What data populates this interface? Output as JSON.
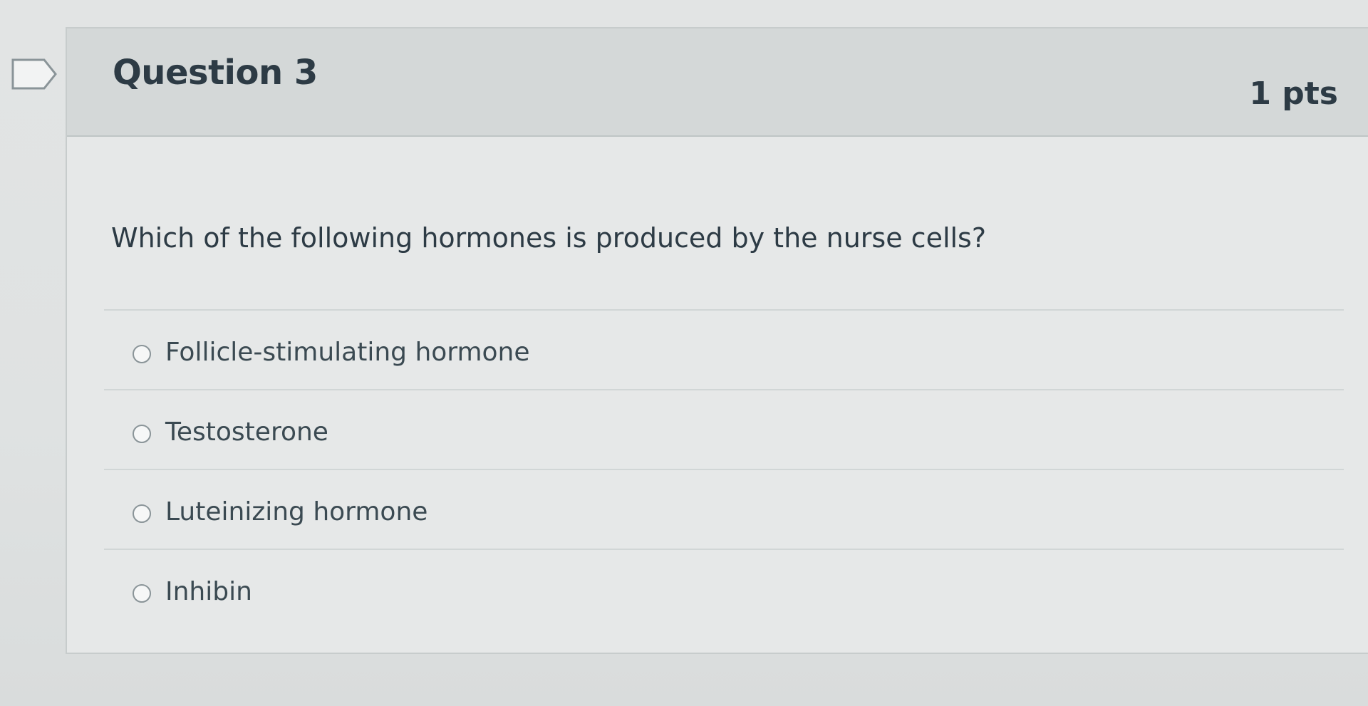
{
  "question": {
    "title": "Question 3",
    "points": "1 pts",
    "text": "Which of the following hormones is produced by the nurse cells?",
    "flag_icon": "flag-outline-icon"
  },
  "answers": [
    {
      "label": "Follicle-stimulating hormone"
    },
    {
      "label": "Testosterone"
    },
    {
      "label": "Luteinizing hormone"
    },
    {
      "label": "Inhibin"
    }
  ],
  "colors": {
    "text": "#2d3b45",
    "header_bg": "#d4d8d8",
    "card_bg": "#e6e8e8",
    "divider": "#d1d6d6",
    "radio_border": "#8a9498"
  }
}
